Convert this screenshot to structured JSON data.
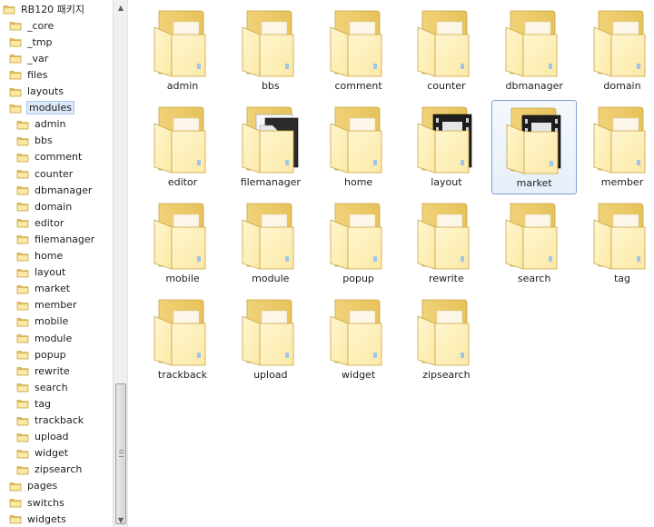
{
  "tree": {
    "root_label": "RB120 패키지",
    "top_folders": [
      "_core",
      "_tmp",
      "_var",
      "files",
      "layouts",
      "modules"
    ],
    "module_folders": [
      "admin",
      "bbs",
      "comment",
      "counter",
      "dbmanager",
      "domain",
      "editor",
      "filemanager",
      "home",
      "layout",
      "market",
      "member",
      "mobile",
      "module",
      "popup",
      "rewrite",
      "search",
      "tag",
      "trackback",
      "upload",
      "widget",
      "zipsearch"
    ],
    "bottom_folders": [
      "pages",
      "switchs",
      "widgets"
    ],
    "selected": "modules"
  },
  "content": {
    "items": [
      {
        "label": "admin",
        "type": "folder"
      },
      {
        "label": "bbs",
        "type": "folder"
      },
      {
        "label": "comment",
        "type": "folder"
      },
      {
        "label": "counter",
        "type": "folder"
      },
      {
        "label": "dbmanager",
        "type": "folder"
      },
      {
        "label": "domain",
        "type": "folder"
      },
      {
        "label": "editor",
        "type": "folder"
      },
      {
        "label": "filemanager",
        "type": "folder-doc"
      },
      {
        "label": "home",
        "type": "folder"
      },
      {
        "label": "layout",
        "type": "folder-media"
      },
      {
        "label": "market",
        "type": "folder-media"
      },
      {
        "label": "member",
        "type": "folder"
      },
      {
        "label": "mobile",
        "type": "folder"
      },
      {
        "label": "module",
        "type": "folder"
      },
      {
        "label": "popup",
        "type": "folder"
      },
      {
        "label": "rewrite",
        "type": "folder"
      },
      {
        "label": "search",
        "type": "folder"
      },
      {
        "label": "tag",
        "type": "folder"
      },
      {
        "label": "trackback",
        "type": "folder"
      },
      {
        "label": "upload",
        "type": "folder"
      },
      {
        "label": "widget",
        "type": "folder"
      },
      {
        "label": "zipsearch",
        "type": "folder"
      }
    ],
    "selected": "market"
  },
  "colors": {
    "folder_light": "#fbe9a6",
    "folder_dark": "#e7c25b",
    "folder_edge": "#c9a442",
    "selection_border": "#7da2ce"
  }
}
